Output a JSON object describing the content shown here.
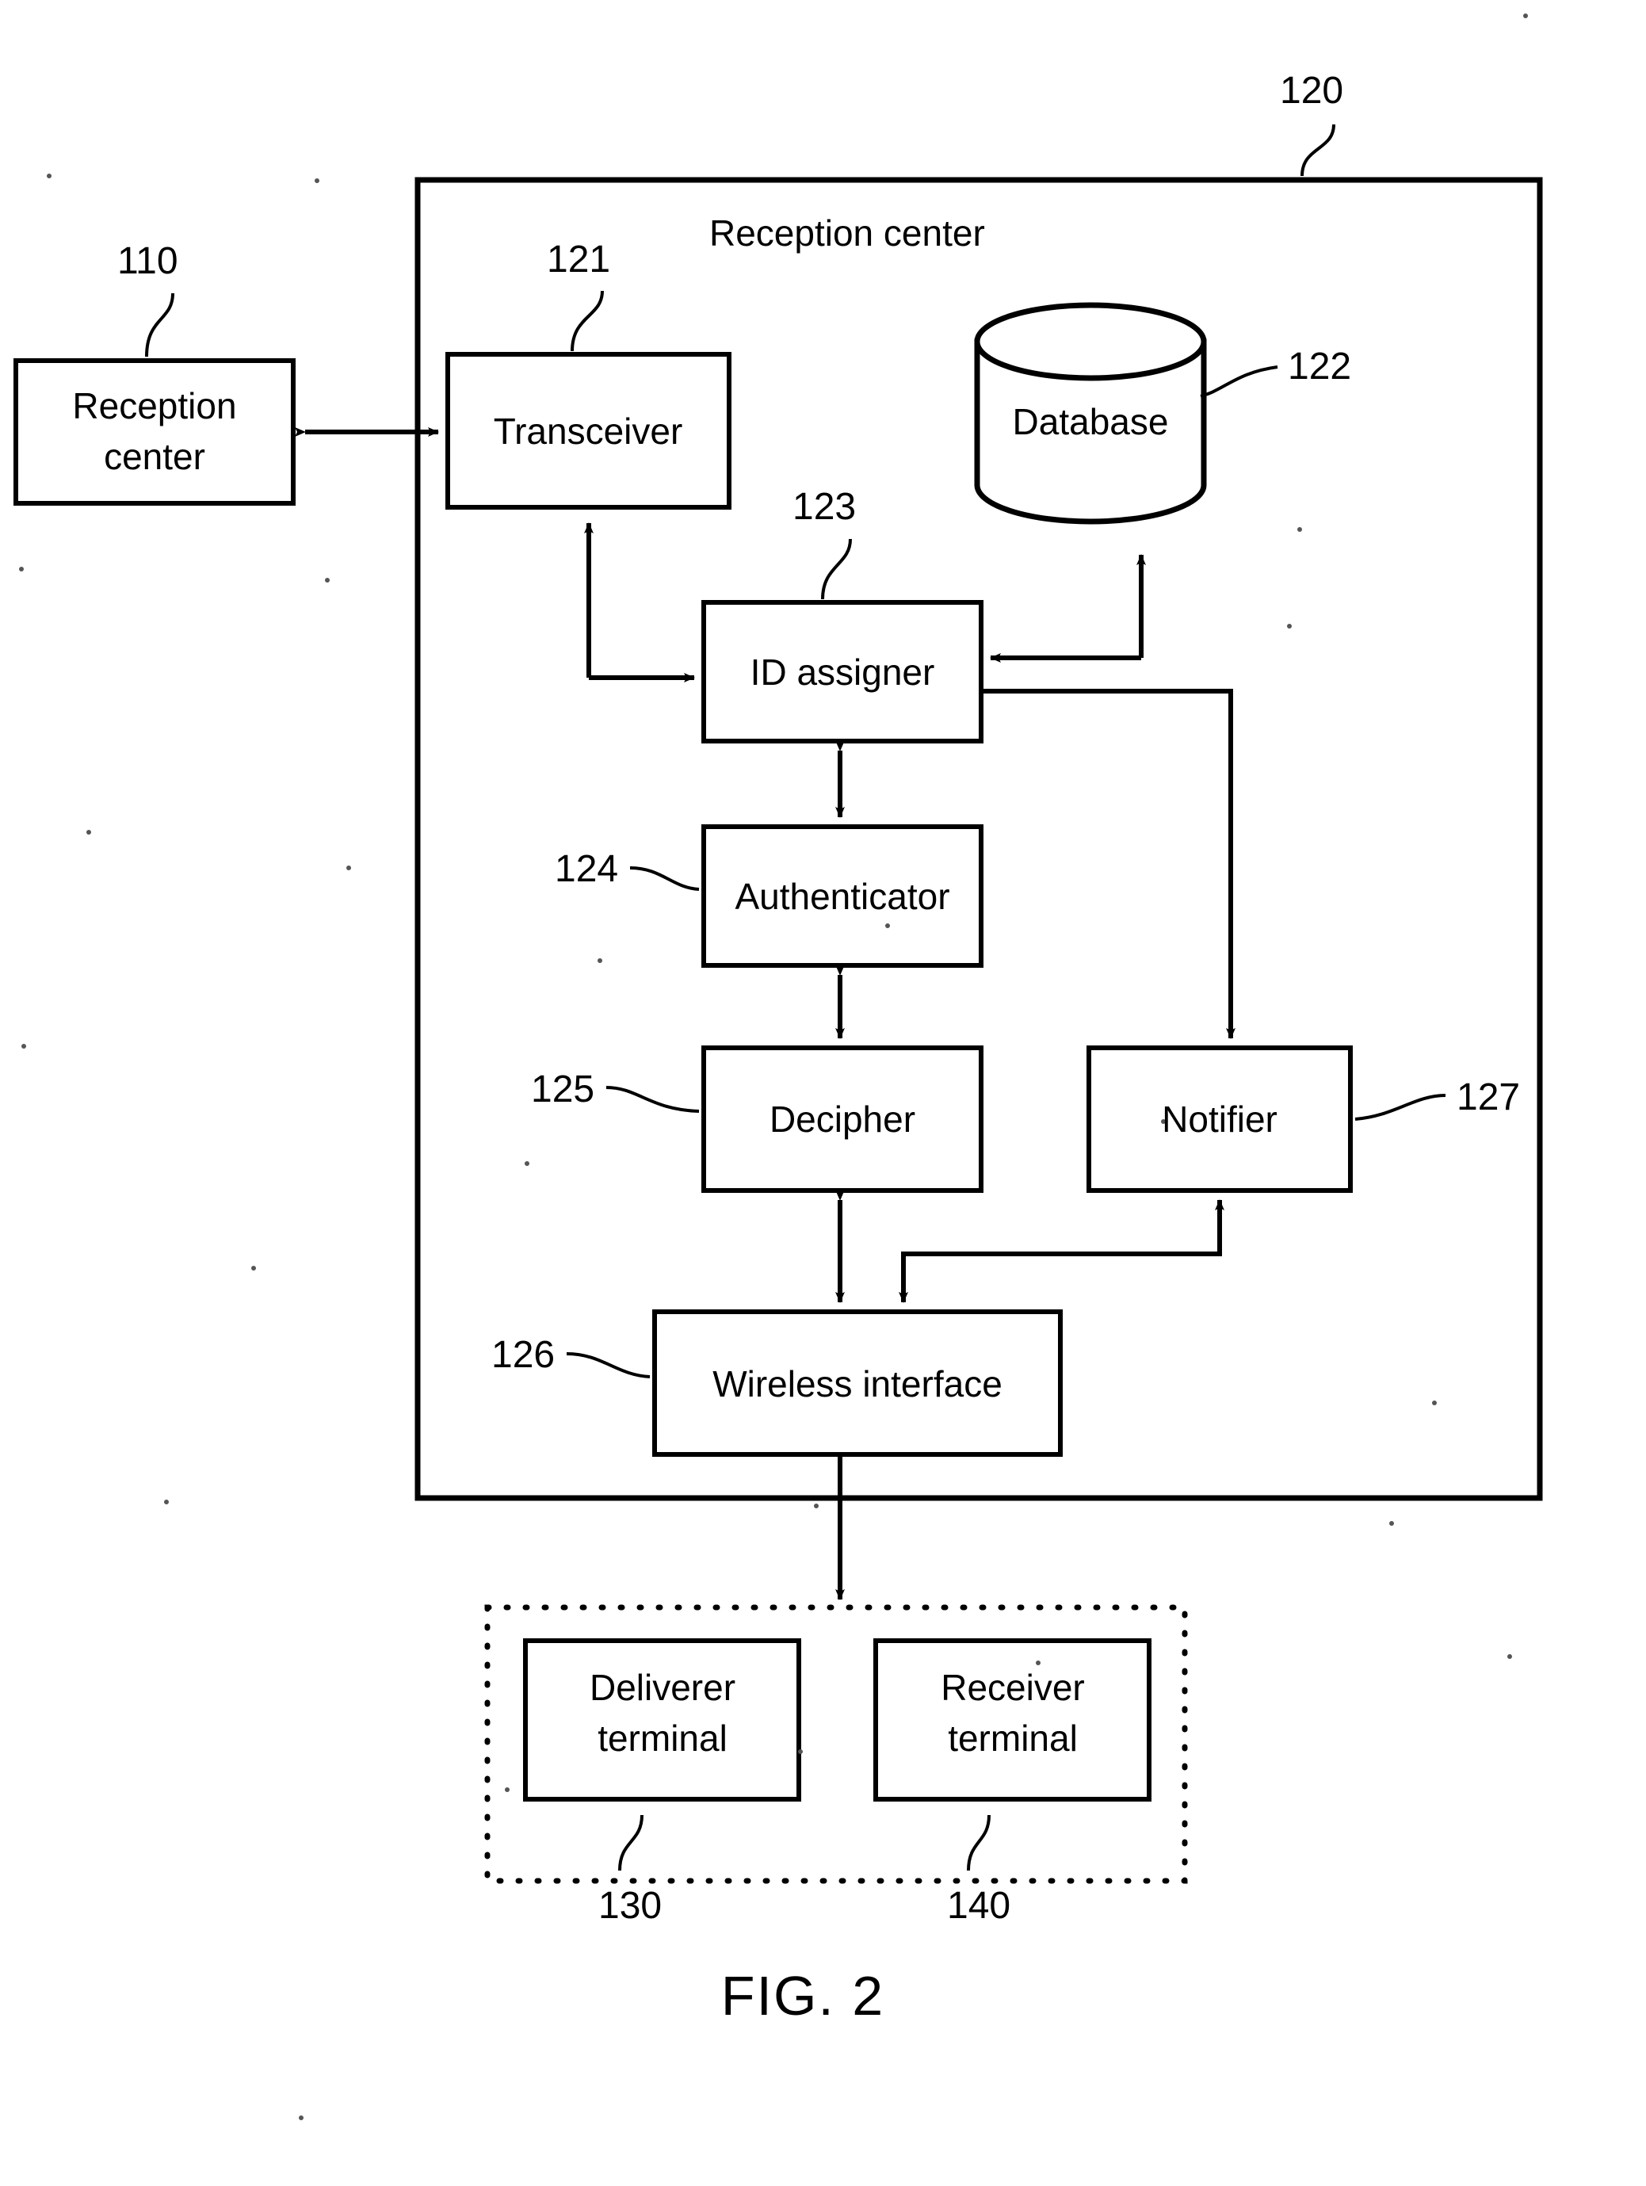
{
  "figure": {
    "caption": "FIG. 2",
    "outer_container": {
      "title": "Reception center",
      "ref": "120"
    },
    "external": {
      "reception_center": {
        "label_line1": "Reception",
        "label_line2": "center",
        "ref": "110"
      }
    },
    "blocks": [
      {
        "id": "transceiver",
        "label": "Transceiver",
        "ref": "121"
      },
      {
        "id": "database",
        "label": "Database",
        "ref": "122"
      },
      {
        "id": "id-assigner",
        "label": "ID assigner",
        "ref": "123"
      },
      {
        "id": "authenticator",
        "label": "Authenticator",
        "ref": "124"
      },
      {
        "id": "decipher",
        "label": "Decipher",
        "ref": "125"
      },
      {
        "id": "wireless-interface",
        "label": "Wireless interface",
        "ref": "126"
      },
      {
        "id": "notifier",
        "label": "Notifier",
        "ref": "127"
      }
    ],
    "terminal_group": {
      "deliverer_terminal": {
        "label_line1": "Deliverer",
        "label_line2": "terminal",
        "ref": "130"
      },
      "receiver_terminal": {
        "label_line1": "Receiver",
        "label_line2": "terminal",
        "ref": "140"
      }
    },
    "colors": {
      "ink": "#000000",
      "paper": "#ffffff"
    }
  }
}
